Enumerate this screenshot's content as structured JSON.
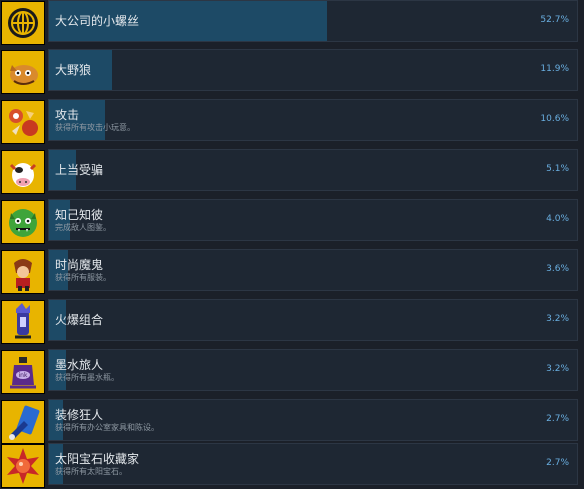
{
  "achievements": [
    {
      "title": "大公司的小螺丝",
      "desc": "",
      "percent_label": "52.7%",
      "percent": 52.7,
      "icon": "globe-icon"
    },
    {
      "title": "大野狼",
      "desc": "",
      "percent_label": "11.9%",
      "percent": 11.9,
      "icon": "wolf-icon"
    },
    {
      "title": "攻击",
      "desc": "获得所有攻击小玩意。",
      "percent_label": "10.6%",
      "percent": 10.6,
      "icon": "attack-icon"
    },
    {
      "title": "上当受骗",
      "desc": "",
      "percent_label": "5.1%",
      "percent": 5.1,
      "icon": "cow-icon"
    },
    {
      "title": "知己知彼",
      "desc": "完成敌人图鉴。",
      "percent_label": "4.0%",
      "percent": 4.0,
      "icon": "monster-icon"
    },
    {
      "title": "时尚魔鬼",
      "desc": "获得所有服装。",
      "percent_label": "3.6%",
      "percent": 3.6,
      "icon": "fashion-icon"
    },
    {
      "title": "火爆组合",
      "desc": "",
      "percent_label": "3.2%",
      "percent": 3.2,
      "icon": "combo-icon"
    },
    {
      "title": "墨水旅人",
      "desc": "获得所有墨水瓶。",
      "percent_label": "3.2%",
      "percent": 3.2,
      "icon": "ink-bottle-icon"
    },
    {
      "title": "装修狂人",
      "desc": "获得所有办公室家具和陈设。",
      "percent_label": "2.7%",
      "percent": 2.7,
      "icon": "decor-icon"
    },
    {
      "title": "太阳宝石收藏家",
      "desc": "获得所有太阳宝石。",
      "percent_label": "2.7%",
      "percent": 2.7,
      "icon": "sun-gem-icon"
    }
  ]
}
